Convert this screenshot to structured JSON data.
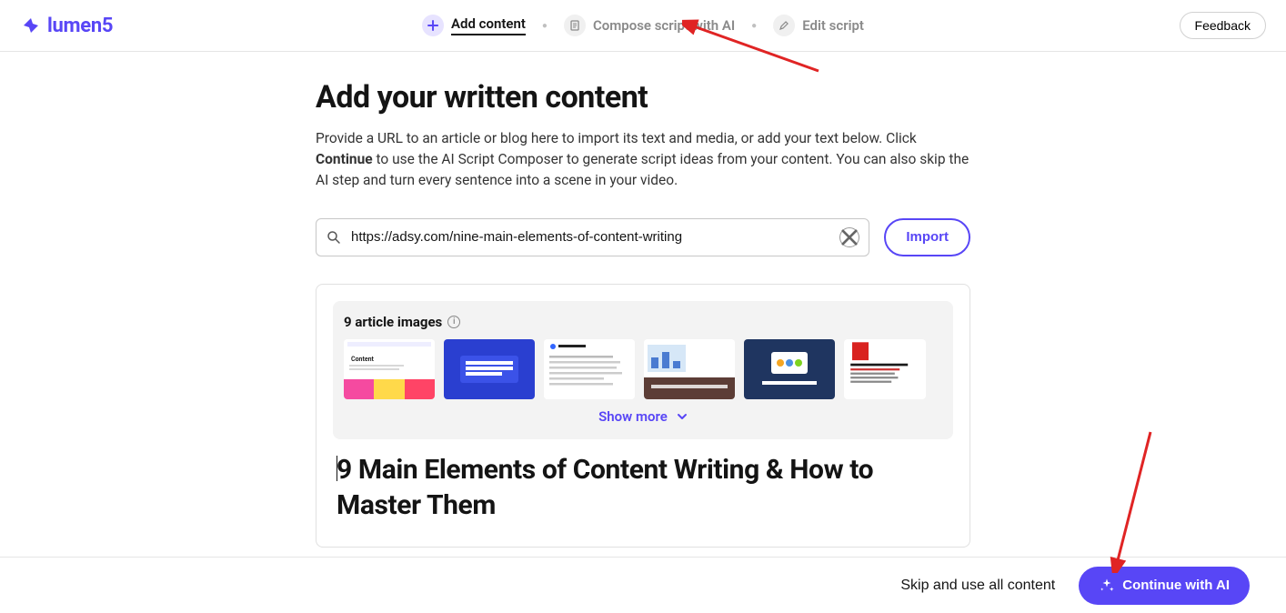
{
  "brand": {
    "name": "lumen5"
  },
  "header": {
    "steps": [
      {
        "id": "add",
        "label": "Add content",
        "active": true
      },
      {
        "id": "compose",
        "label": "Compose script with AI",
        "active": false
      },
      {
        "id": "edit",
        "label": "Edit script",
        "active": false
      }
    ],
    "feedback_label": "Feedback"
  },
  "main": {
    "title": "Add your written content",
    "description_pre": "Provide a URL to an article or blog here to import its text and media, or add your text below. Click ",
    "description_bold": "Continue",
    "description_post": " to use the AI Script Composer to generate script ideas from your content. You can also skip the AI step and turn every sentence into a scene in your video.",
    "url_value": "https://adsy.com/nine-main-elements-of-content-writing",
    "import_label": "Import",
    "images_count_label": "9 article images",
    "show_more_label": "Show more",
    "article_title": "9 Main Elements of Content Writing & How to Master Them"
  },
  "footer": {
    "skip_label": "Skip and use all content",
    "continue_label": "Continue with AI"
  }
}
